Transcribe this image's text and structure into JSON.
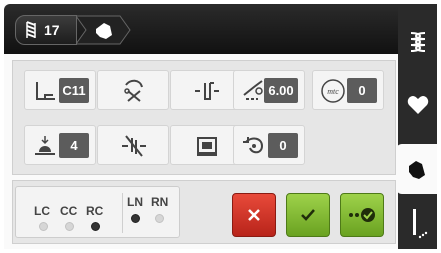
{
  "header": {
    "stitch_number": "17",
    "stitch_icon": "stitch-pattern-icon",
    "presser_icon": "presser-foot-icon"
  },
  "sidetabs": [
    {
      "icon": "stitch-pattern-icon"
    },
    {
      "icon": "heart-icon"
    },
    {
      "icon": "presser-foot-icon",
      "active": true
    },
    {
      "icon": "needle-icon"
    }
  ],
  "settings": {
    "foot": {
      "icon": "foot-icon",
      "value": "C11"
    },
    "thread_cutter": {
      "icon": "thread-cutter-icon"
    },
    "needle_stop": {
      "icon": "needle-stop-icon"
    },
    "stitch_length": {
      "icon": "stitch-length-icon",
      "value": "6.00"
    },
    "mtc": {
      "icon": "mtc-icon",
      "label": "mtc",
      "value": "0"
    },
    "foot_pressure": {
      "icon": "foot-pressure-icon",
      "value": "4"
    },
    "thread_cut_off": {
      "icon": "thread-cut-off-icon"
    },
    "display": {
      "icon": "display-icon"
    },
    "reverse": {
      "icon": "reverse-icon",
      "value": "0"
    }
  },
  "feet_selector": {
    "left_labels": [
      "LC",
      "CC",
      "RC"
    ],
    "left_active_index": 2,
    "right_labels": [
      "LN",
      "RN"
    ],
    "right_active_index": 0
  },
  "buttons": {
    "cancel": "cancel-icon",
    "confirm": "check-icon",
    "confirm_sequence": "sequence-check-icon"
  },
  "colors": {
    "cancel": "#d23427",
    "confirm": "#82bb34",
    "value_box": "#5c5c5c"
  }
}
